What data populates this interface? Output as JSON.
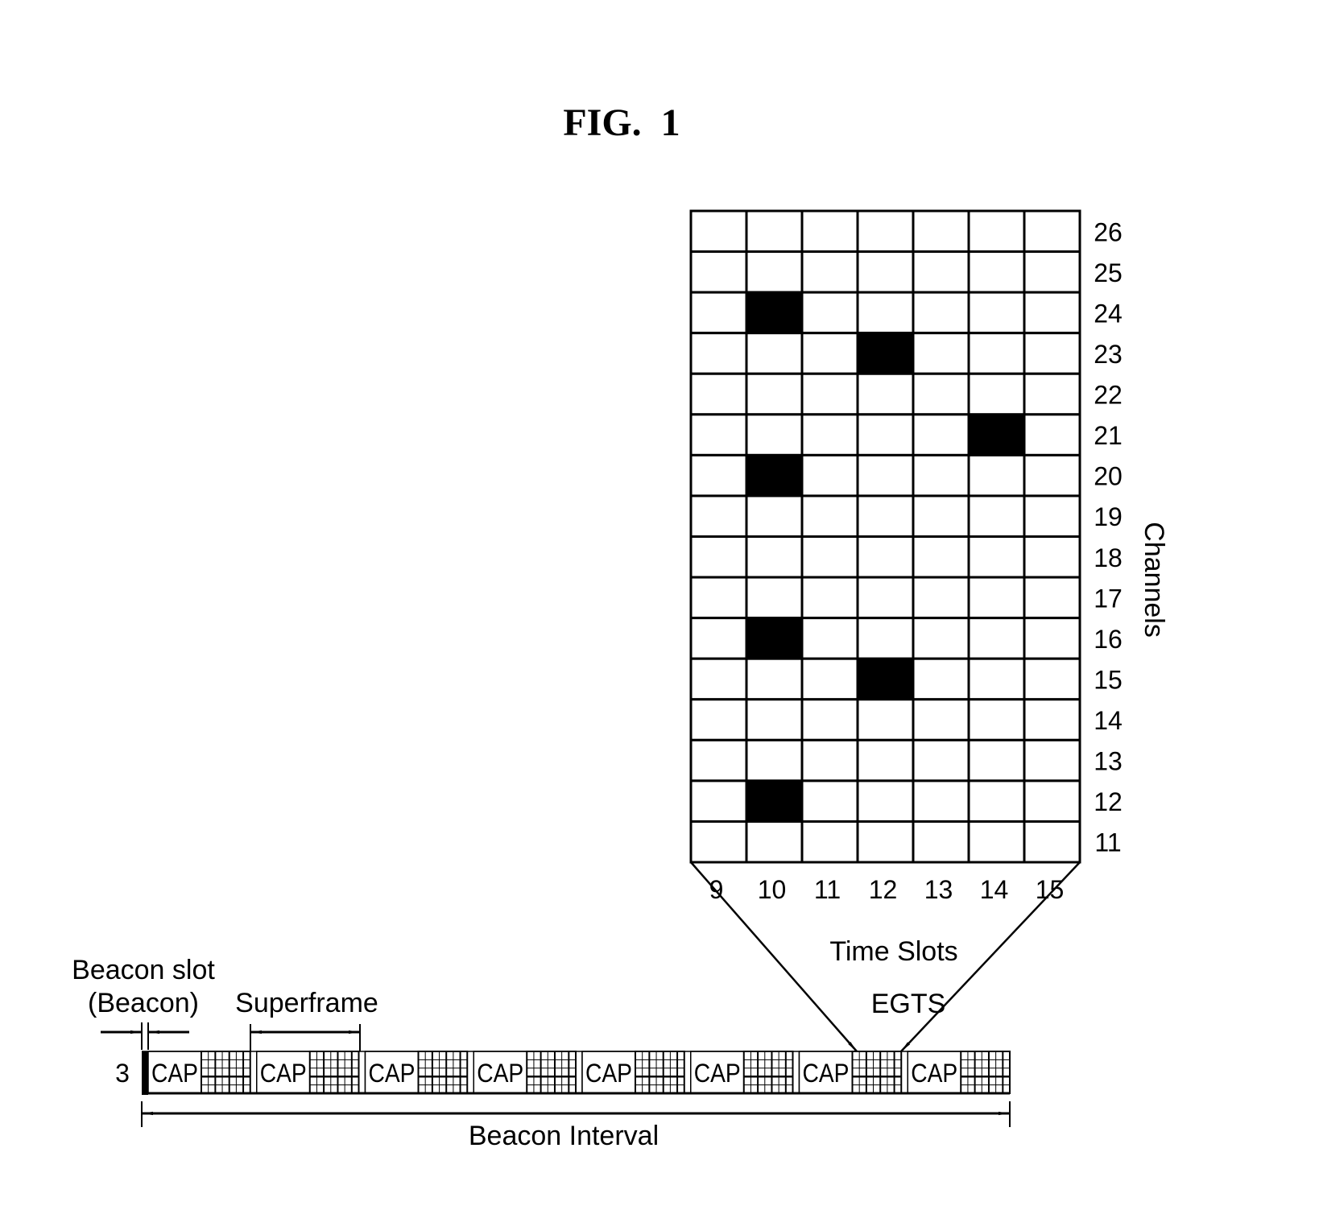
{
  "figure": {
    "title": "FIG.  1"
  },
  "channel_grid": {
    "axis_label": "Channels",
    "x_axis_label": "Time Slots",
    "channels": [
      26,
      25,
      24,
      23,
      22,
      21,
      20,
      19,
      18,
      17,
      16,
      15,
      14,
      13,
      12,
      11
    ],
    "channel_labels": [
      "26",
      "25",
      "24",
      "23",
      "22",
      "21",
      "20",
      "19",
      "18",
      "17",
      "16",
      "15",
      "14",
      "13",
      "12",
      "11"
    ],
    "time_slots": [
      9,
      10,
      11,
      12,
      13,
      14,
      15
    ],
    "time_slot_labels": [
      "9",
      "10",
      "11",
      "12",
      "13",
      "14",
      "15"
    ],
    "occupied_cells": [
      {
        "time_slot": 10,
        "channel": 24
      },
      {
        "time_slot": 12,
        "channel": 23
      },
      {
        "time_slot": 14,
        "channel": 21
      },
      {
        "time_slot": 10,
        "channel": 20
      },
      {
        "time_slot": 10,
        "channel": 16
      },
      {
        "time_slot": 12,
        "channel": 15
      },
      {
        "time_slot": 10,
        "channel": 12
      }
    ],
    "filled_color": "#000000",
    "empty_color": "#ffffff"
  },
  "timeline": {
    "row_label": "3",
    "beacon_slot_label_line1": "Beacon slot",
    "beacon_slot_label_line2": "(Beacon)",
    "superframe_label": "Superframe",
    "egts_label": "EGTS",
    "beacon_interval_label": "Beacon Interval",
    "superframe_count": 8,
    "egts_superframe_index": 6,
    "segments": [
      {
        "cap_label": "CAP"
      },
      {
        "cap_label": "CAP"
      },
      {
        "cap_label": "CAP"
      },
      {
        "cap_label": "CAP"
      },
      {
        "cap_label": "CAP"
      },
      {
        "cap_label": "CAP"
      },
      {
        "cap_label": "CAP"
      },
      {
        "cap_label": "CAP"
      }
    ]
  }
}
